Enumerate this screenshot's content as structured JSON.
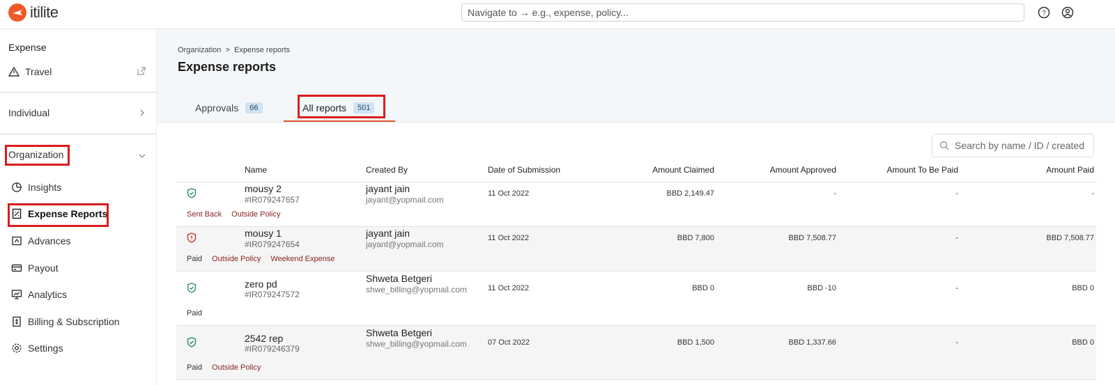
{
  "app": {
    "brand": "itilite",
    "brand_color": "#ef5a28"
  },
  "header": {
    "search_placeholder": "Navigate to → e.g., expense, policy..."
  },
  "sidebar": {
    "title": "Expense",
    "travel": "Travel",
    "individual": "Individual",
    "organization": "Organization",
    "items": [
      {
        "label": "Insights",
        "icon": "pie-chart-icon"
      },
      {
        "label": "Expense Reports",
        "icon": "receipt-icon"
      },
      {
        "label": "Advances",
        "icon": "advance-icon"
      },
      {
        "label": "Payout",
        "icon": "card-icon"
      },
      {
        "label": "Analytics",
        "icon": "presentation-chart-icon"
      },
      {
        "label": "Billing & Subscription",
        "icon": "bill-icon"
      },
      {
        "label": "Settings",
        "icon": "gear-icon"
      }
    ]
  },
  "breadcrumb": {
    "root": "Organization",
    "sep": ">",
    "current": "Expense reports"
  },
  "page_title": "Expense reports",
  "tabs": [
    {
      "label": "Approvals",
      "count": "66"
    },
    {
      "label": "All reports",
      "count": "501"
    }
  ],
  "table": {
    "search_placeholder": "Search by name / ID / created",
    "columns": [
      "Name",
      "Created By",
      "Date of Submission",
      "Amount Claimed",
      "Amount Approved",
      "Amount To Be Paid",
      "Amount Paid"
    ],
    "rows": [
      {
        "name": "mousy 2",
        "id": "#IR079247657",
        "creator": "jayant jain",
        "email": "jayant@yopmail.com",
        "date": "11 Oct 2022",
        "claimed": "BBD 2,149.47",
        "approved": "-",
        "to_be_paid": "-",
        "paid": "-",
        "status": "Sent Back",
        "tags": [
          "Outside Policy"
        ],
        "shield": "green"
      },
      {
        "name": "mousy 1",
        "id": "#IR079247654",
        "creator": "jayant jain",
        "email": "jayant@yopmail.com",
        "date": "11 Oct 2022",
        "claimed": "BBD 7,800",
        "approved": "BBD 7,508.77",
        "to_be_paid": "-",
        "paid": "BBD 7,508.77",
        "status": "Paid",
        "tags": [
          "Outside Policy",
          "Weekend Expense"
        ],
        "shield": "red"
      },
      {
        "name": "zero pd",
        "id": "#IR079247572",
        "creator": "Shweta Betgeri",
        "email": "shwe_billing@yopmail.com",
        "date": "11 Oct 2022",
        "claimed": "BBD 0",
        "approved": "BBD -10",
        "to_be_paid": "-",
        "paid": "BBD 0",
        "status": "Paid",
        "tags": [],
        "shield": "green"
      },
      {
        "name": "2542 rep",
        "id": "#IR079246379",
        "creator": "Shweta Betgeri",
        "email": "shwe_billing@yopmail.com",
        "date": "07 Oct 2022",
        "claimed": "BBD 1,500",
        "approved": "BBD 1,337.66",
        "to_be_paid": "-",
        "paid": "BBD 0",
        "status": "Paid",
        "tags": [
          "Outside Policy"
        ],
        "shield": "green"
      }
    ]
  }
}
